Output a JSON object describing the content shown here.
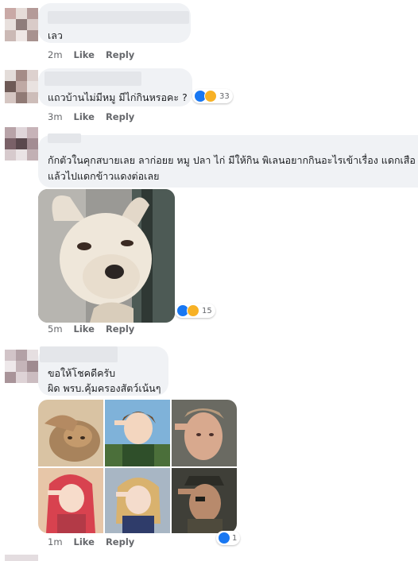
{
  "comments": [
    {
      "text_lines": [
        "เลว"
      ],
      "time": "2m",
      "like": "Like",
      "reply": "Reply"
    },
    {
      "text_lines": [
        "แถวบ้านไม่มีหมู มีไก่กินหรอคะ ?"
      ],
      "time": "3m",
      "like": "Like",
      "reply": "Reply",
      "reaction_count": "33"
    },
    {
      "text_lines": [
        "กักตัวในคุกสบายเลย ลาก่อยย หมู ปลา ไก่ มีให้กิน พิเลนอยากกินอะไรเข้าเรื่อง แดกเสือ",
        "แล้วไปแดกข้าวแดงต่อเลย"
      ],
      "time": "5m",
      "like": "Like",
      "reply": "Reply",
      "reaction_count": "15",
      "image": "chihuahua-dog-photo"
    },
    {
      "text_lines": [
        "ขอให้โชคดีครับ",
        "ผิด พรบ.คุ้มครองสัตว์เน้นๆ"
      ],
      "time": "1m",
      "like": "Like",
      "reply": "Reply",
      "reaction_count": "1",
      "image": "salute-collage-photo"
    }
  ],
  "colors": {
    "bubble": "#f0f2f5",
    "meta": "#65676b",
    "like_blue": "#1877f2",
    "haha_yellow": "#f7b125"
  }
}
